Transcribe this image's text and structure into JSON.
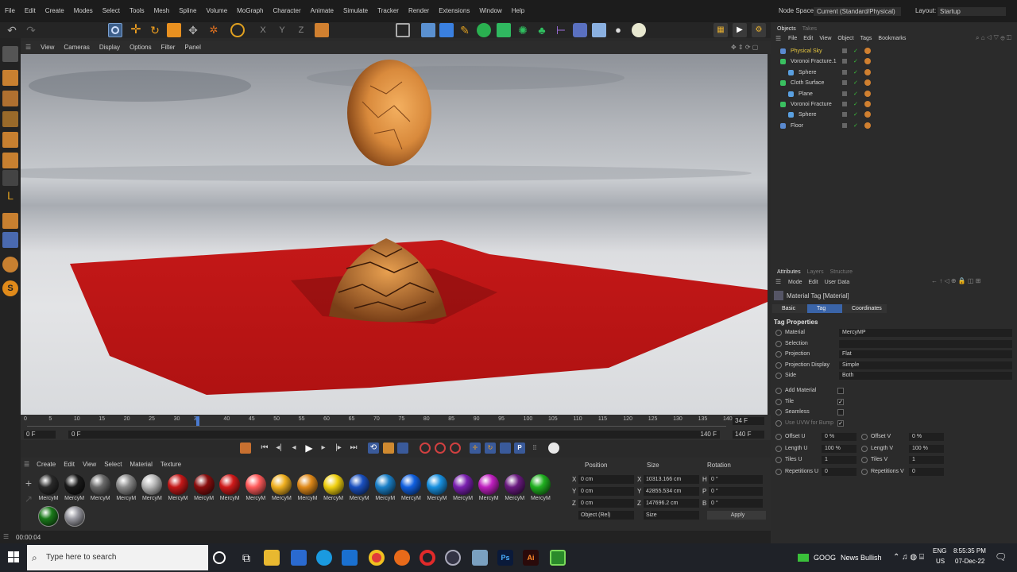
{
  "menubar": {
    "items": [
      "File",
      "Edit",
      "Create",
      "Modes",
      "Select",
      "Tools",
      "Mesh",
      "Spline",
      "Volume",
      "MoGraph",
      "Character",
      "Animate",
      "Simulate",
      "Tracker",
      "Render",
      "Extensions",
      "Window",
      "Help"
    ],
    "node_space_label": "Node Space:",
    "node_space_value": "Current (Standard/Physical)",
    "layout_label": "Layout:",
    "layout_value": "Startup"
  },
  "toolbar": {
    "axis_x": "X",
    "axis_y": "Y",
    "axis_z": "Z"
  },
  "viewport": {
    "menu": [
      "View",
      "Cameras",
      "Display",
      "Options",
      "Filter",
      "Panel"
    ]
  },
  "timeline": {
    "ticks": [
      "0",
      "5",
      "10",
      "15",
      "20",
      "25",
      "30",
      "34",
      "40",
      "45",
      "50",
      "55",
      "60",
      "65",
      "70",
      "75",
      "80",
      "85",
      "90",
      "95",
      "100",
      "105",
      "110",
      "115",
      "120",
      "125",
      "130",
      "135",
      "140"
    ],
    "current_frame": "34 F",
    "start_a": "0 F",
    "start_b": "0 F",
    "end_a": "140 F",
    "end_b": "140 F"
  },
  "materials": {
    "menu": [
      "Create",
      "Edit",
      "View",
      "Select",
      "Material",
      "Texture"
    ],
    "items": [
      {
        "label": "MercyM",
        "color": "#2a2a2a"
      },
      {
        "label": "MercyM",
        "color": "#1a1a1a"
      },
      {
        "label": "MercyM",
        "color": "#6a6a6a"
      },
      {
        "label": "MercyM",
        "color": "#8a8a8a"
      },
      {
        "label": "MercyM",
        "color": "#b8b8b8"
      },
      {
        "label": "MercyM",
        "color": "#c41818"
      },
      {
        "label": "MercyM",
        "color": "#8a0e0e"
      },
      {
        "label": "MercyM",
        "color": "#d01a1a"
      },
      {
        "label": "MercyM",
        "color": "#ff5a5a"
      },
      {
        "label": "MercyM",
        "color": "#f0b020"
      },
      {
        "label": "MercyM",
        "color": "#e08a1a"
      },
      {
        "label": "MercyM",
        "color": "#f0d010"
      },
      {
        "label": "MercyM",
        "color": "#1a50c0"
      },
      {
        "label": "MercyM",
        "color": "#1a80c8"
      },
      {
        "label": "MercyM",
        "color": "#1060e0"
      },
      {
        "label": "MercyM",
        "color": "#1890e0"
      },
      {
        "label": "MercyM",
        "color": "#7a20b0"
      },
      {
        "label": "MercyM",
        "color": "#c020c0"
      },
      {
        "label": "MercyM",
        "color": "#6a1a80"
      },
      {
        "label": "MercyM",
        "color": "#20b020"
      }
    ],
    "row2": [
      {
        "color": "#1a7a1a"
      },
      {
        "color": "#9a9aa2"
      }
    ]
  },
  "coords": {
    "position_label": "Position",
    "size_label": "Size",
    "rotation_label": "Rotation",
    "rows": [
      {
        "axis": "X",
        "pos": "0 cm",
        "saxis": "X",
        "size": "10313.166 cm",
        "raxis": "H",
        "rot": "0 °"
      },
      {
        "axis": "Y",
        "pos": "0 cm",
        "saxis": "Y",
        "size": "42855.534 cm",
        "raxis": "P",
        "rot": "0 °"
      },
      {
        "axis": "Z",
        "pos": "0 cm",
        "saxis": "Z",
        "size": "147696.2 cm",
        "raxis": "B",
        "rot": "0 °"
      }
    ],
    "mode": "Object (Rel)",
    "size_mode": "Size",
    "apply": "Apply"
  },
  "status": {
    "time": "00:00:04"
  },
  "objects": {
    "tabs": [
      "Objects",
      "Takes"
    ],
    "menu": [
      "File",
      "Edit",
      "View",
      "Object",
      "Tags",
      "Bookmarks"
    ],
    "items": [
      {
        "name": "Physical Sky",
        "indent": 0,
        "color": "#e8c840",
        "icon": "#5a8ad0"
      },
      {
        "name": "Voronoi Fracture.1",
        "indent": 0,
        "color": "#d0d0d0",
        "icon": "#3ac060"
      },
      {
        "name": "Sphere",
        "indent": 1,
        "color": "#d0d0d0",
        "icon": "#5aa0e0"
      },
      {
        "name": "Cloth Surface",
        "indent": 0,
        "color": "#d0d0d0",
        "icon": "#3ac060"
      },
      {
        "name": "Plane",
        "indent": 1,
        "color": "#d0d0d0",
        "icon": "#5aa0e0"
      },
      {
        "name": "Voronoi Fracture",
        "indent": 0,
        "color": "#d0d0d0",
        "icon": "#3ac060"
      },
      {
        "name": "Sphere",
        "indent": 1,
        "color": "#d0d0d0",
        "icon": "#5aa0e0"
      },
      {
        "name": "Floor",
        "indent": 0,
        "color": "#d0d0d0",
        "icon": "#5a8ad0"
      }
    ]
  },
  "attributes": {
    "tabs": [
      "Attributes",
      "Layers",
      "Structure"
    ],
    "menu": [
      "Mode",
      "Edit",
      "User Data"
    ],
    "title": "Material Tag [Material]",
    "subtabs": [
      "Basic",
      "Tag",
      "Coordinates"
    ],
    "section": "Tag Properties",
    "props": [
      {
        "label": "Material",
        "value": "MercyMP"
      },
      {
        "label": "Selection",
        "value": ""
      },
      {
        "label": "Projection",
        "value": "Flat"
      },
      {
        "label": "Projection Display",
        "value": "Simple"
      },
      {
        "label": "Side",
        "value": "Both"
      }
    ],
    "checks": [
      {
        "label": "Add Material",
        "checked": false
      },
      {
        "label": "Tile",
        "checked": true
      },
      {
        "label": "Seamless",
        "checked": false
      },
      {
        "label": "Use UVW for Bump",
        "checked": true
      }
    ],
    "left": [
      {
        "label": "Offset U",
        "value": "0 %"
      },
      {
        "label": "Length U",
        "value": "100 %"
      },
      {
        "label": "Tiles U",
        "value": "1"
      },
      {
        "label": "Repetitions U",
        "value": "0"
      }
    ],
    "right": [
      {
        "label": "Offset V",
        "value": "0 %"
      },
      {
        "label": "Length V",
        "value": "100 %"
      },
      {
        "label": "Tiles V",
        "value": "1"
      },
      {
        "label": "Repetitions V",
        "value": "0"
      }
    ]
  },
  "taskbar": {
    "search_placeholder": "Type here to search",
    "ticker": "GOOG",
    "news": "News Bullish",
    "lang": "ENG",
    "region": "US",
    "time": "8:55:35 PM",
    "date": "07-Dec-22"
  }
}
